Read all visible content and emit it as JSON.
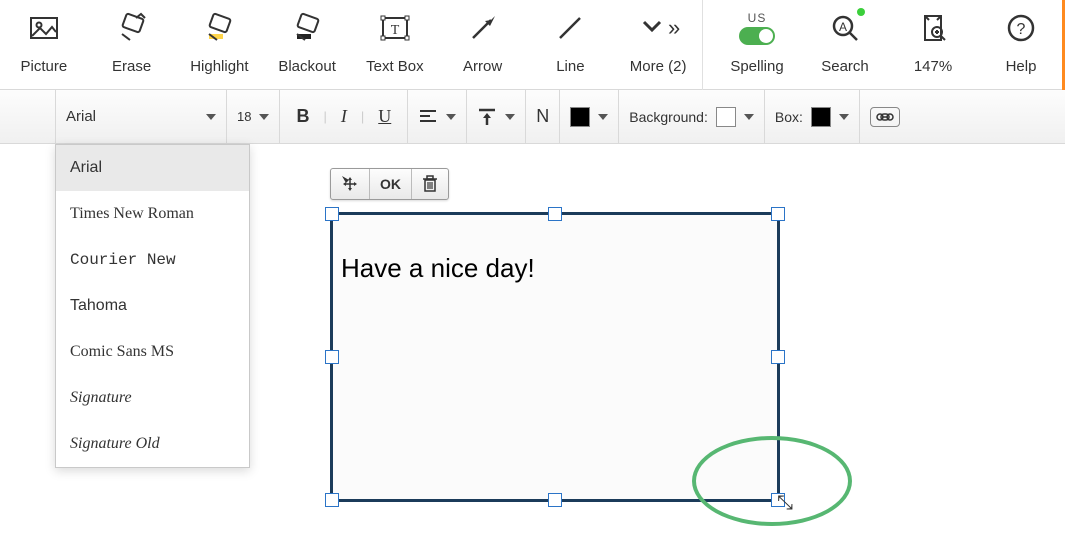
{
  "toolbar": {
    "picture": "Picture",
    "erase": "Erase",
    "highlight": "Highlight",
    "blackout": "Blackout",
    "textbox": "Text Box",
    "arrow": "Arrow",
    "line": "Line",
    "more": "More (2)",
    "spelling": "Spelling",
    "spelling_lang": "US",
    "search": "Search",
    "zoom": "147%",
    "help": "Help"
  },
  "formatbar": {
    "font": "Arial",
    "size": "18",
    "n_label": "N",
    "background_label": "Background:",
    "box_label": "Box:",
    "text_color": "#000000",
    "background_color": "#ffffff",
    "box_color": "#000000"
  },
  "font_dropdown": {
    "options": [
      "Arial",
      "Times New Roman",
      "Courier New",
      "Tahoma",
      "Comic Sans MS",
      "Signature",
      "Signature Old"
    ],
    "selected": "Arial"
  },
  "mini_toolbar": {
    "ok": "OK"
  },
  "textbox": {
    "content": "Have a nice day!"
  }
}
